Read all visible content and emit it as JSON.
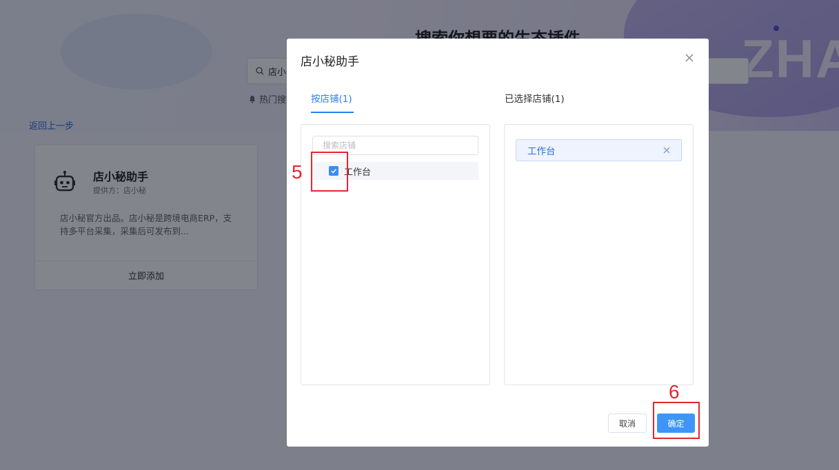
{
  "background": {
    "brand_text": "ZHA",
    "title": "搜索你想要的生态插件",
    "search_value": "店小",
    "hot_label": "热门搜",
    "back_link": "返回上一步",
    "card": {
      "name": "店小秘助手",
      "provider": "提供方：店小秘",
      "description": "店小秘官方出品。店小秘是跨境电商ERP，支持多平台采集，采集后可发布到...",
      "add_button": "立即添加"
    }
  },
  "modal": {
    "title": "店小秘助手",
    "tabs": {
      "by_store": "按店铺(1)",
      "selected": "已选择店铺(1)"
    },
    "store_search_placeholder": "搜索店铺",
    "stores": [
      {
        "label": "工作台",
        "checked": true
      }
    ],
    "selected_stores": [
      {
        "label": "工作台"
      }
    ],
    "cancel_label": "取消",
    "ok_label": "确定"
  },
  "annotations": {
    "step5": "5",
    "step6": "6"
  },
  "colors": {
    "accent": "#2d7ef0",
    "primary_button": "#3f95f7",
    "annotation": "#e3262f"
  },
  "icons": {
    "close": "close-icon",
    "check": "checkmark-icon",
    "tag_remove": "close-icon",
    "search": "search-icon",
    "bell": "bell-icon",
    "robot": "robot-icon"
  }
}
